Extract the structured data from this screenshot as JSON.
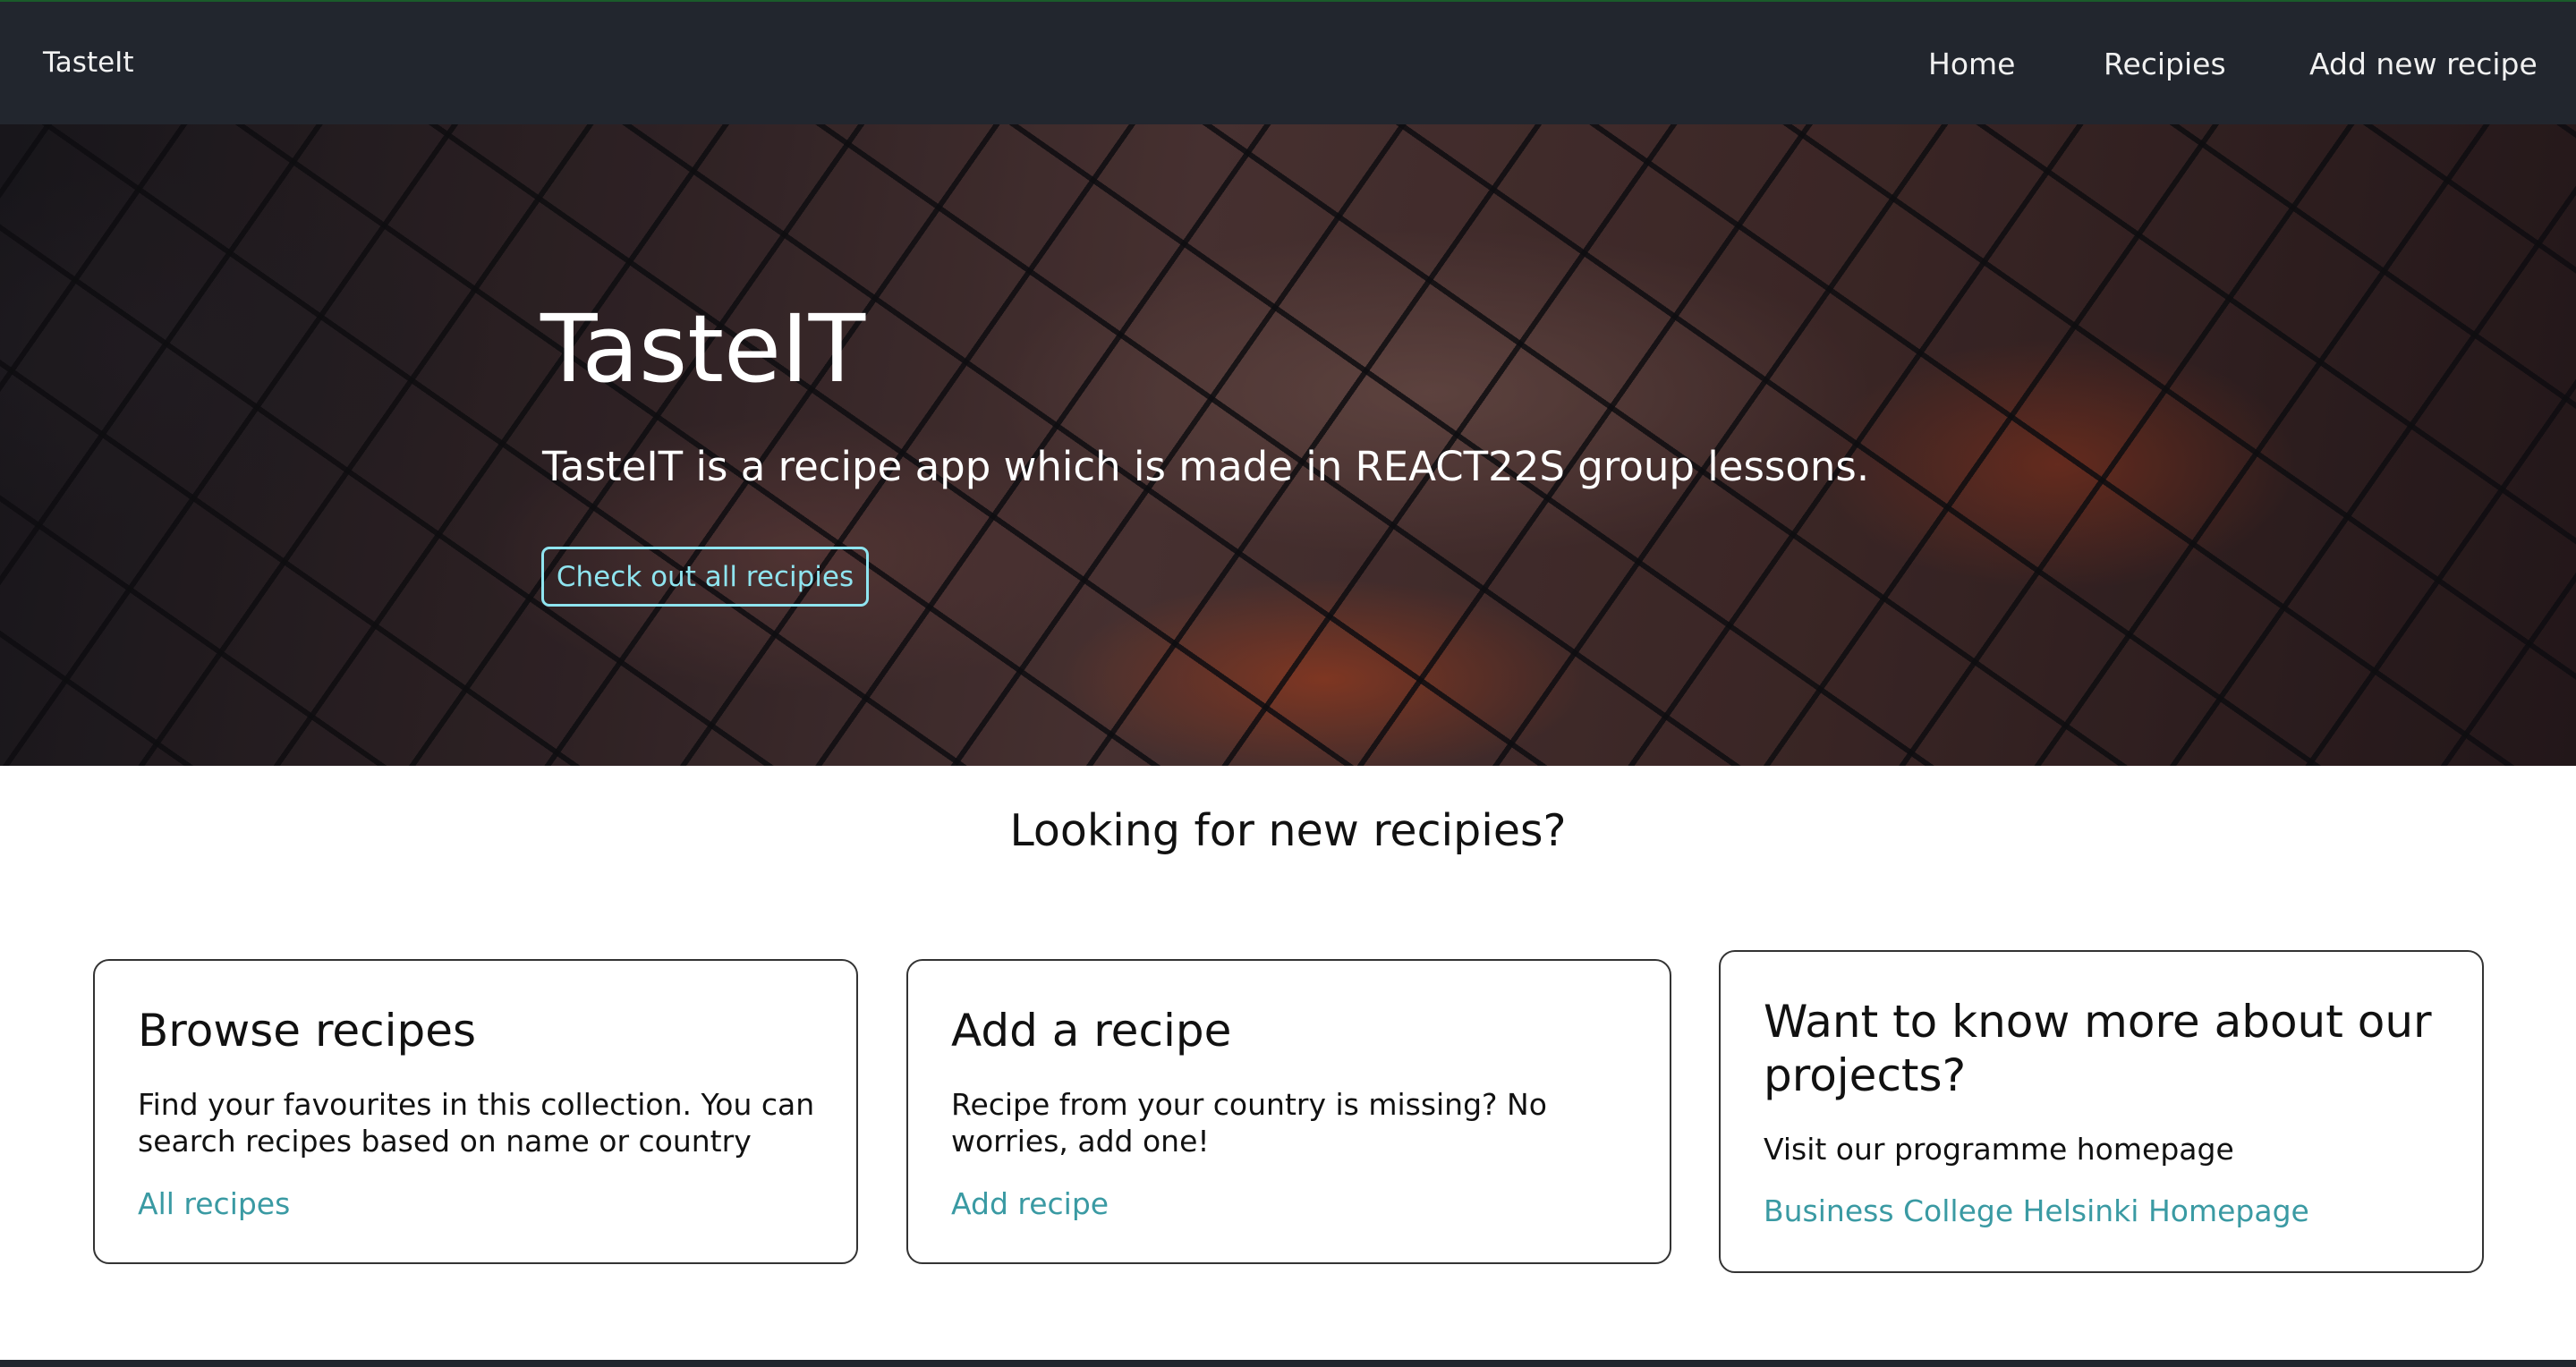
{
  "navbar": {
    "brand": "TasteIt",
    "links": [
      "Home",
      "Recipies",
      "Add new recipe"
    ]
  },
  "hero": {
    "title": "TasteIT",
    "lead": "TasteIT is a recipe app which is made in REACT22S group lessons.",
    "button_label": "Check out all recipies"
  },
  "section_title": "Looking for new recipies?",
  "cards": [
    {
      "title": "Browse recipes",
      "text": "Find your favourites in this collection. You can search recipes based on name or country",
      "link": "All recipes"
    },
    {
      "title": "Add a recipe",
      "text": "Recipe from your country is missing? No worries, add one!",
      "link": "Add recipe"
    },
    {
      "title": "Want to know more about our projects?",
      "text": "Visit our programme homepage",
      "link": "Business College Helsinki Homepage"
    }
  ],
  "colors": {
    "navbar_bg": "#22262e",
    "accent_button": "#8fe4ef",
    "link": "#3a9aa3"
  }
}
